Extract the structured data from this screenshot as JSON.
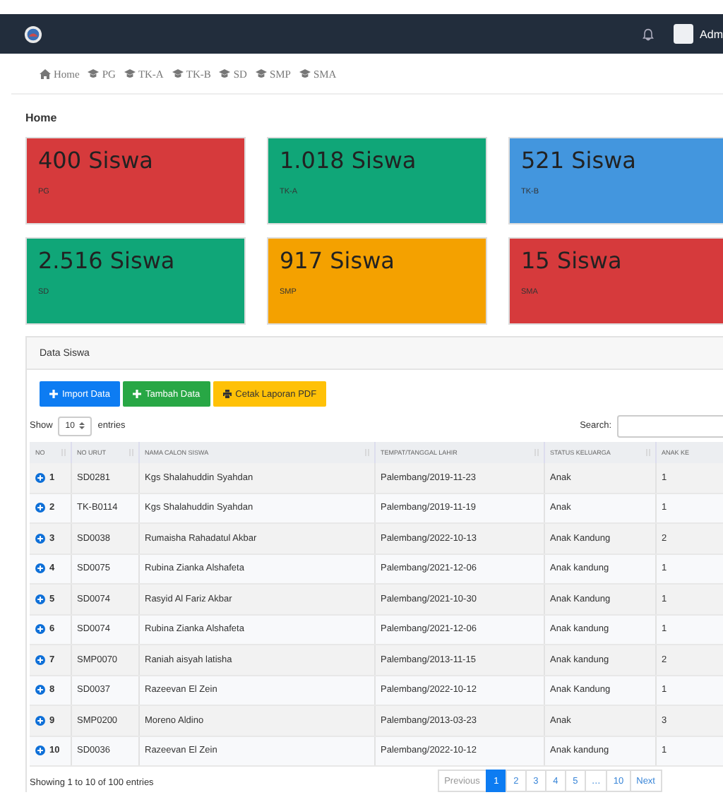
{
  "topbar": {
    "user": "Adm"
  },
  "nav": [
    {
      "label": "Home",
      "kind": "home"
    },
    {
      "label": "PG",
      "kind": "cap"
    },
    {
      "label": "TK-A",
      "kind": "cap"
    },
    {
      "label": "TK-B",
      "kind": "cap"
    },
    {
      "label": "SD",
      "kind": "cap"
    },
    {
      "label": "SMP",
      "kind": "cap"
    },
    {
      "label": "SMA",
      "kind": "cap"
    }
  ],
  "page_title": "Home",
  "stats": [
    {
      "value": "400 Siswa",
      "label": "PG",
      "color": "#d63a3c"
    },
    {
      "value": "1.018 Siswa",
      "label": "TK-A",
      "color": "#10a678"
    },
    {
      "value": "521 Siswa",
      "label": "TK-B",
      "color": "#4396de"
    },
    {
      "value": "2.516 Siswa",
      "label": "SD",
      "color": "#10a678"
    },
    {
      "value": "917 Siswa",
      "label": "SMP",
      "color": "#f4a100"
    },
    {
      "value": "15 Siswa",
      "label": "SMA",
      "color": "#d63a3c"
    }
  ],
  "panel": {
    "title": "Data Siswa",
    "buttons": [
      {
        "label": "Import Data",
        "kind": "plus",
        "color": "#0d7cf2"
      },
      {
        "label": "Tambah Data",
        "kind": "plus",
        "color": "#28a745"
      },
      {
        "label": "Cetak Laporan PDF",
        "kind": "print",
        "color": "#ffc107"
      }
    ],
    "show_label": "Show",
    "page_size": "10",
    "entries_label": "entries",
    "search_label": "Search:",
    "table": {
      "columns": [
        "NO",
        "NO URUT",
        "NAMA CALON SISWA",
        "TEMPAT/TANGGAL LAHIR",
        "STATUS KELUARGA",
        "ANAK KE"
      ],
      "rows": [
        [
          "1",
          "SD0281",
          "Kgs Shalahuddin Syahdan",
          "Palembang/2019-11-23",
          "Anak",
          "1"
        ],
        [
          "2",
          "TK-B0114",
          "Kgs Shalahuddin Syahdan",
          "Palembang/2019-11-19",
          "Anak",
          "1"
        ],
        [
          "3",
          "SD0038",
          "Rumaisha Rahadatul Akbar",
          "Palembang/2022-10-13",
          "Anak Kandung",
          "2"
        ],
        [
          "4",
          "SD0075",
          "Rubina Zianka Alshafeta",
          "Palembang/2021-12-06",
          "Anak kandung",
          "1"
        ],
        [
          "5",
          "SD0074",
          "Rasyid Al Fariz Akbar",
          "Palembang/2021-10-30",
          "Anak Kandung",
          "1"
        ],
        [
          "6",
          "SD0074",
          "Rubina Zianka Alshafeta",
          "Palembang/2021-12-06",
          "Anak kandung",
          "1"
        ],
        [
          "7",
          "SMP0070",
          "Raniah aisyah latisha",
          "Palembang/2013-11-15",
          "Anak kandung",
          "2"
        ],
        [
          "8",
          "SD0037",
          "Razeevan El Zein",
          "Palembang/2022-10-12",
          "Anak Kandung",
          "1"
        ],
        [
          "9",
          "SMP0200",
          "Moreno Aldino",
          "Palembang/2013-03-23",
          "Anak",
          "3"
        ],
        [
          "10",
          "SD0036",
          "Razeevan El Zein",
          "Palembang/2022-10-12",
          "Anak kandung",
          "1"
        ]
      ]
    },
    "info": "Showing 1 to 10 of 100 entries",
    "pagination": [
      {
        "label": "Previous",
        "selected": false
      },
      {
        "label": "1",
        "selected": true
      },
      {
        "label": "2",
        "selected": false
      },
      {
        "label": "3",
        "selected": false
      },
      {
        "label": "4",
        "selected": false
      },
      {
        "label": "5",
        "selected": false
      },
      {
        "label": "…",
        "selected": false
      },
      {
        "label": "10",
        "selected": false
      },
      {
        "label": "Next",
        "selected": false
      }
    ]
  }
}
